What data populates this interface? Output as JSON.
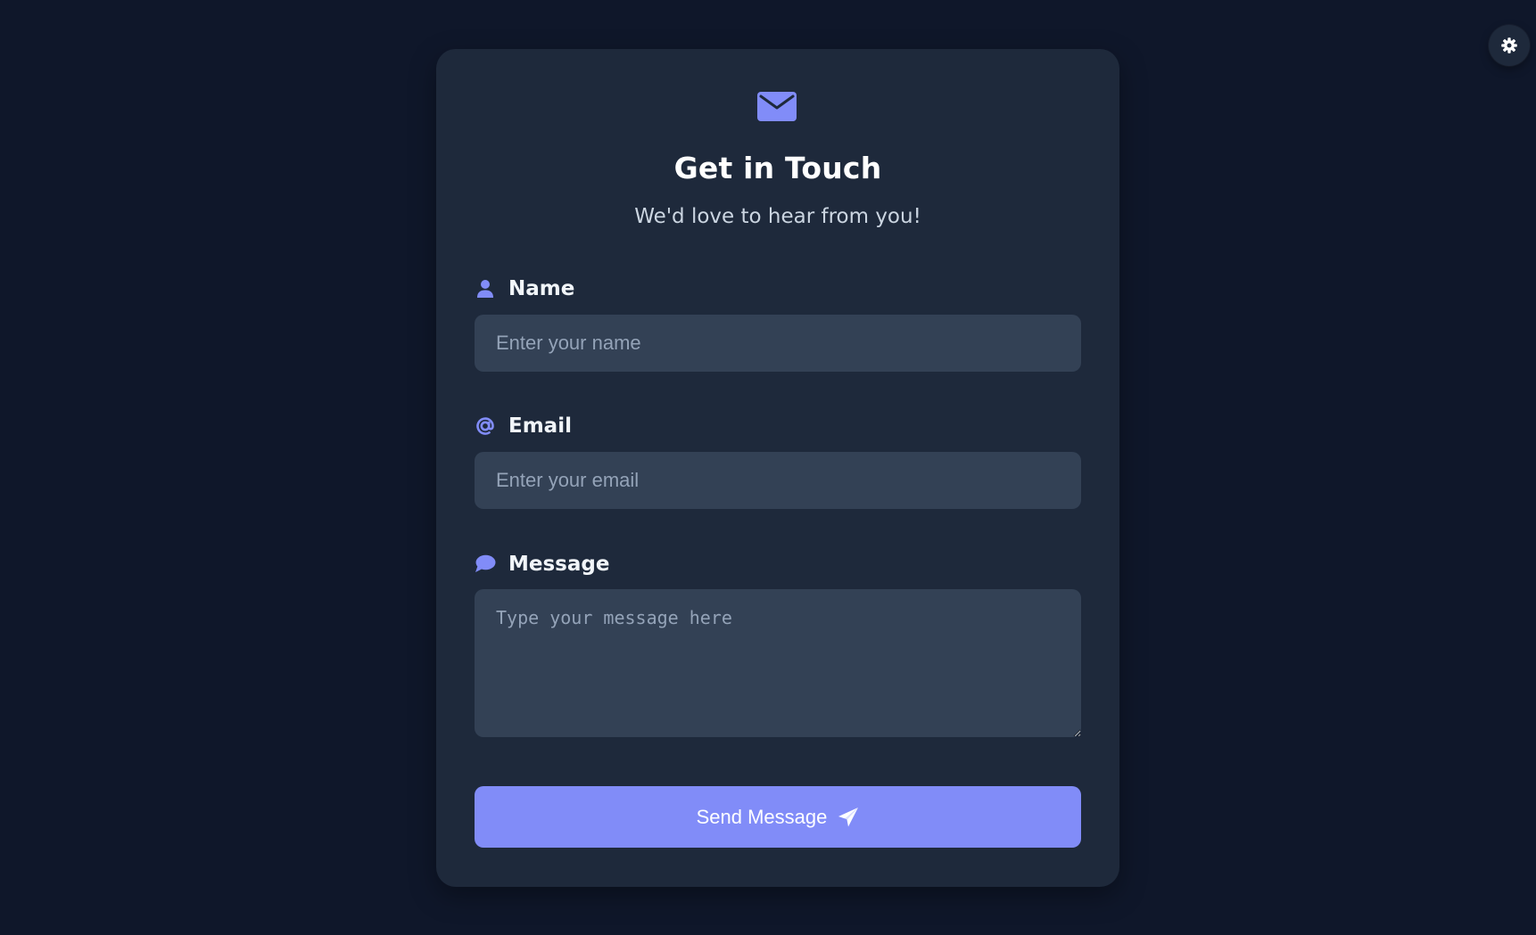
{
  "theme_toggle": {
    "icon": "gear-icon"
  },
  "header": {
    "icon": "envelope-icon",
    "title": "Get in Touch",
    "subtitle": "We'd love to hear from you!"
  },
  "form": {
    "name": {
      "label": "Name",
      "icon": "user-icon",
      "placeholder": "Enter your name",
      "value": ""
    },
    "email": {
      "label": "Email",
      "icon": "at-icon",
      "placeholder": "Enter your email",
      "value": ""
    },
    "message": {
      "label": "Message",
      "icon": "speech-bubble-icon",
      "placeholder": "Type your message here",
      "value": ""
    },
    "submit": {
      "label": "Send Message",
      "icon": "paper-plane-icon"
    }
  },
  "colors": {
    "background": "#0f172a",
    "card": "#1e293b",
    "input": "#334155",
    "accent": "#818cf8",
    "text": "#ffffff"
  }
}
